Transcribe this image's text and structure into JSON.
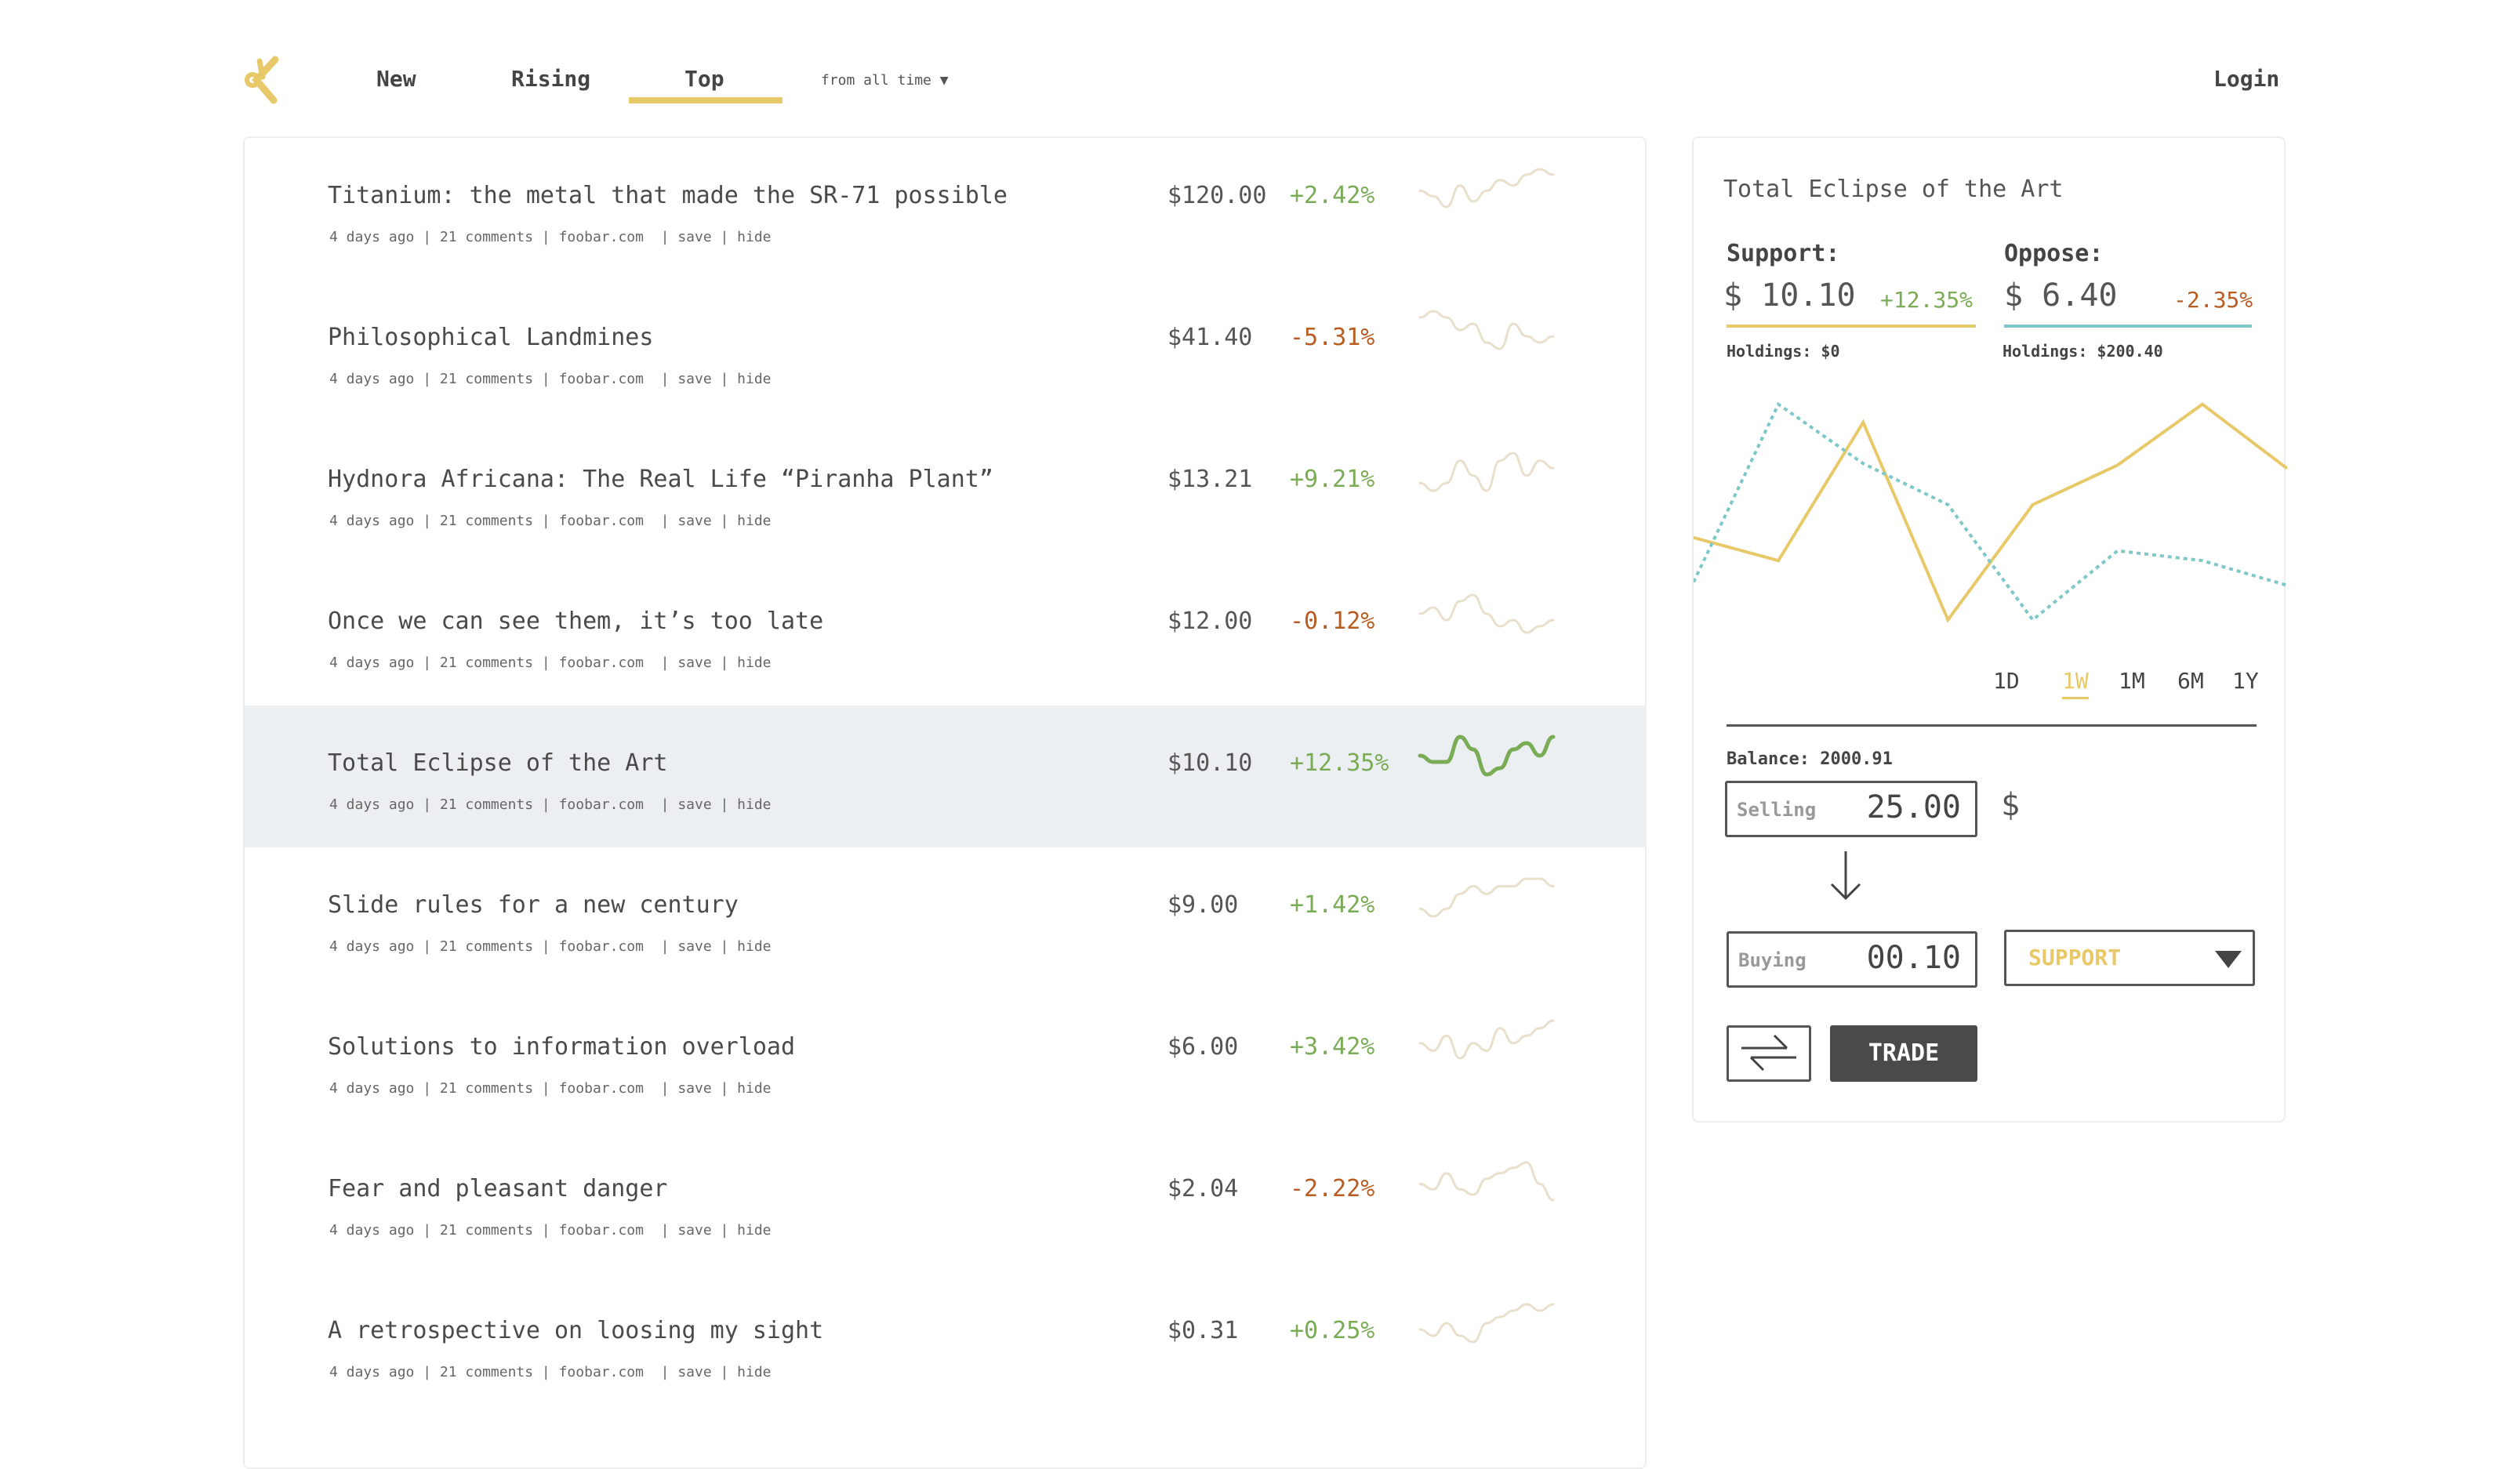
{
  "nav": {
    "items": [
      "New",
      "Rising",
      "Top"
    ],
    "active": "Top",
    "filter": "from all time ▼",
    "login": "Login"
  },
  "colors": {
    "accent": "#e8c96a",
    "teal": "#7ec8c8",
    "up": "#7aab55",
    "down": "#b85c22",
    "highlight": "#eceff2"
  },
  "posts": [
    {
      "title": "Titanium: the metal that made the SR-71 possible",
      "meta": "4 days ago | 21 comments | foobar.com  | save | hide",
      "price": "$120.00",
      "change": "+2.42%",
      "up": true,
      "spark": [
        4,
        3,
        1,
        5,
        2,
        4,
        6,
        5,
        7,
        8,
        7
      ]
    },
    {
      "title": "Philosophical Landmines",
      "meta": "4 days ago | 21 comments | foobar.com  | save | hide",
      "price": "$41.40",
      "change": "-5.31%",
      "up": false,
      "spark": [
        7,
        8,
        7,
        5,
        6,
        3,
        2,
        6,
        4,
        3,
        4
      ]
    },
    {
      "title": "Hydnora Africana: The Real Life “Piranha Plant”",
      "meta": "4 days ago | 21 comments | foobar.com  | save | hide",
      "price": "$13.21",
      "change": "+9.21%",
      "up": true,
      "spark": [
        3,
        2,
        3,
        6,
        4,
        2,
        6,
        7,
        4,
        6,
        5
      ]
    },
    {
      "title": "Once we can see them, it’s too late",
      "meta": "4 days ago | 21 comments | foobar.com  | save | hide",
      "price": "$12.00",
      "change": "-0.12%",
      "up": false,
      "spark": [
        4,
        5,
        3,
        6,
        7,
        4,
        2,
        3,
        1,
        2,
        3
      ]
    },
    {
      "title": "Total Eclipse of the Art",
      "meta": "4 days ago | 21 comments | foobar.com  | save | hide",
      "price": "$10.10",
      "change": "+12.35%",
      "up": true,
      "active": true,
      "spark": [
        4,
        3,
        3,
        7,
        5,
        1,
        2,
        5,
        6,
        4,
        7
      ]
    },
    {
      "title": "Slide rules for a new century",
      "meta": "4 days ago | 21 comments | foobar.com  | save | hide",
      "price": "$9.00",
      "change": "+1.42%",
      "up": true,
      "spark": [
        3,
        2,
        3,
        5,
        6,
        5,
        6,
        6,
        7,
        7,
        6
      ]
    },
    {
      "title": "Solutions to information overload",
      "meta": "4 days ago | 21 comments | foobar.com  | save | hide",
      "price": "$6.00",
      "change": "+3.42%",
      "up": true,
      "spark": [
        4,
        3,
        5,
        2,
        4,
        3,
        6,
        4,
        5,
        6,
        7
      ]
    },
    {
      "title": "Fear and pleasant danger",
      "meta": "4 days ago | 21 comments | foobar.com  | save | hide",
      "price": "$2.04",
      "change": "-2.22%",
      "up": false,
      "spark": [
        4,
        3,
        6,
        3,
        2,
        5,
        6,
        7,
        8,
        4,
        1
      ]
    },
    {
      "title": "A retrospective on loosing my sight",
      "meta": "4 days ago | 21 comments | foobar.com  | save | hide",
      "price": "$0.31",
      "change": "+0.25%",
      "up": true,
      "spark": [
        4,
        3,
        5,
        3,
        2,
        5,
        6,
        7,
        8,
        7,
        8
      ]
    }
  ],
  "detail": {
    "title": "Total Eclipse of the Art",
    "support": {
      "label": "Support:",
      "price": "$ 10.10",
      "change": "+12.35%",
      "holdings": "Holdings: $0"
    },
    "oppose": {
      "label": "Oppose:",
      "price": "$ 6.40",
      "change": "-2.35%",
      "holdings": "Holdings: $200.40"
    },
    "periods": [
      "1D",
      "1W",
      "1M",
      "6M",
      "1Y"
    ],
    "active_period": "1W",
    "balance": "Balance: 2000.91",
    "selling": {
      "label": "Selling",
      "value": "25.00",
      "unit": "$"
    },
    "buying": {
      "label": "Buying",
      "value": "00.10"
    },
    "side": "SUPPORT",
    "trade": "TRADE"
  },
  "chart_data": {
    "type": "line",
    "series": [
      {
        "name": "Support",
        "values": [
          62,
          48,
          132,
          12,
          82,
          106,
          143,
          104
        ]
      },
      {
        "name": "Oppose",
        "values": [
          35,
          143,
          107,
          82,
          12,
          54,
          48,
          33
        ]
      }
    ]
  }
}
